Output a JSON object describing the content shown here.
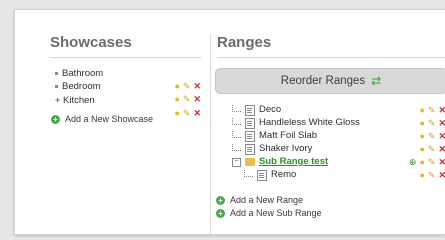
{
  "showcases": {
    "title": "Showcases",
    "items": [
      {
        "label": "Bathroom",
        "marker": "dot"
      },
      {
        "label": "Bedroom",
        "marker": "dot"
      },
      {
        "label": "Kitchen",
        "marker": "plus"
      }
    ],
    "add_label": "Add a New Showcase"
  },
  "ranges": {
    "title": "Ranges",
    "reorder_label": "Reorder Ranges",
    "items": [
      {
        "label": "Deco"
      },
      {
        "label": "Handleless White Gloss"
      },
      {
        "label": "Matt Foil Slab"
      },
      {
        "label": "Shaker Ivory"
      },
      {
        "label": "Sub Range test",
        "type": "folder"
      },
      {
        "label": "Remo",
        "nested": true
      }
    ],
    "add_range_label": "Add a New Range",
    "add_subrange_label": "Add a New Sub Range"
  },
  "icons": {
    "edit": "pencil-icon",
    "delete": "delete-icon",
    "visibility": "bulb-icon"
  },
  "colors": {
    "accent_green": "#2e8f2e",
    "delete_red": "#d02a2a"
  }
}
